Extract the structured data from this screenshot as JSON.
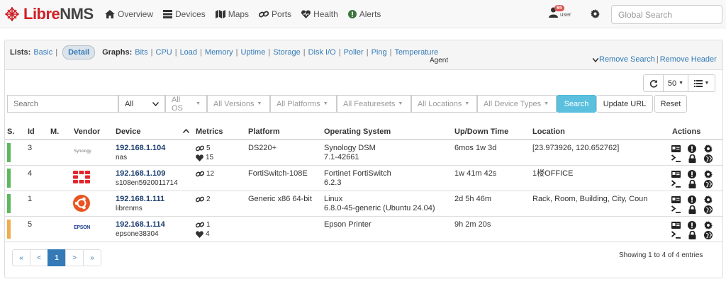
{
  "nav": {
    "logo": {
      "part1": "Libre",
      "part2": "NMS"
    },
    "items": [
      {
        "label": "Overview",
        "icon": "home-icon"
      },
      {
        "label": "Devices",
        "icon": "server-icon"
      },
      {
        "label": "Maps",
        "icon": "map-icon"
      },
      {
        "label": "Ports",
        "icon": "link-icon"
      },
      {
        "label": "Health",
        "icon": "heartbeat-icon"
      },
      {
        "label": "Alerts",
        "icon": "exclamation-circle-icon"
      }
    ],
    "user_badge": "65",
    "user_label": "user",
    "search_placeholder": "Global Search"
  },
  "lists": {
    "title": "Lists:",
    "basic": "Basic",
    "detail": "Detail",
    "graphs_title": "Graphs:",
    "graphs": [
      "Bits",
      "CPU",
      "Load",
      "Memory",
      "Uptime",
      "Storage",
      "Disk I/O",
      "Poller",
      "Ping",
      "Temperature"
    ]
  },
  "agent_select": "Agent",
  "remove_search": "Remove Search",
  "remove_header": "Remove Header",
  "toolbar": {
    "per_page": "50"
  },
  "filters": {
    "search_placeholder": "Search",
    "all": "All",
    "os": "All OS",
    "versions": "All Versions",
    "platforms": "All Platforms",
    "featuresets": "All Featuresets",
    "locations": "All Locations",
    "device_types": "All Device Types",
    "search_btn": "Search",
    "update_url": "Update URL",
    "reset": "Reset"
  },
  "columns": [
    "S.",
    "Id",
    "M.",
    "Vendor",
    "Device",
    "Metrics",
    "Platform",
    "Operating System",
    "Up/Down Time",
    "Location",
    "Actions"
  ],
  "devices": [
    {
      "id": "3",
      "status_color": "#5cb85c",
      "vendor": "Synology",
      "hostname": "192.168.1.104",
      "sysname": "nas",
      "metric1": "5",
      "metric2": "15",
      "platform": "DS220+",
      "os": "Synology DSM",
      "os_version": "7.1-42661",
      "uptime": "6mos 1w 3d",
      "location": "[23.973926, 120.652762]"
    },
    {
      "id": "4",
      "status_color": "#5cb85c",
      "vendor": "Fortinet",
      "hostname": "192.168.1.109",
      "sysname": "s108en5920011714",
      "metric1": "12",
      "metric2": "",
      "platform": "FortiSwitch-108E",
      "os": "Fortinet FortiSwitch",
      "os_version": "6.2.3",
      "uptime": "1w 41m 42s",
      "location": "1楼OFFICE"
    },
    {
      "id": "1",
      "status_color": "#5cb85c",
      "vendor": "Ubuntu",
      "hostname": "192.168.1.111",
      "sysname": "librenms",
      "metric1": "2",
      "metric2": "",
      "platform": "Generic x86 64-bit",
      "os": "Linux",
      "os_version": "6.8.0-45-generic (Ubuntu 24.04)",
      "uptime": "2d 5h 46m",
      "location": "Rack, Room, Building, City, Coun"
    },
    {
      "id": "5",
      "status_color": "#f0ad4e",
      "vendor": "EPSON",
      "hostname": "192.168.1.114",
      "sysname": "epsone38304",
      "metric1": "1",
      "metric2": "4",
      "platform": "",
      "os": "Epson Printer",
      "os_version": "",
      "uptime": "9h 2m 20s",
      "location": ""
    }
  ],
  "pagination": {
    "first": "«",
    "prev": "<",
    "current": "1",
    "next": ">",
    "last": "»"
  },
  "showing": "Showing 1 to 4 of 4 entries"
}
